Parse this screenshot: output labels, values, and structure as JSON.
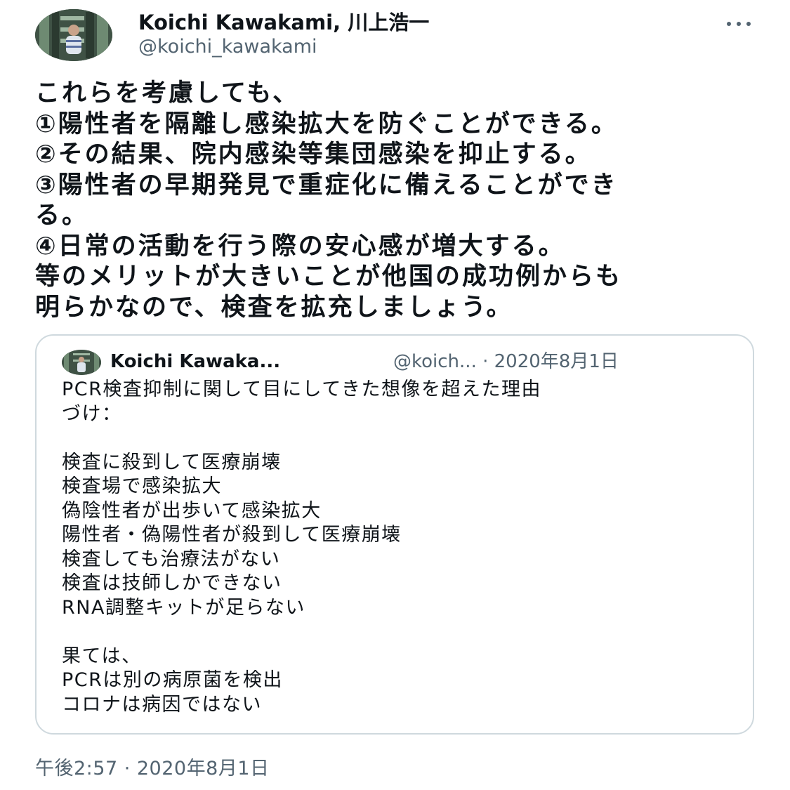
{
  "author": {
    "display_name": "Koichi Kawakami, 川上浩一",
    "handle": "@koichi_kawakami",
    "avatar_icon": "profile-photo"
  },
  "more_icon": "more-horizontal-icon",
  "tweet": {
    "lines": [
      "これらを考慮しても、",
      "①陽性者を隔離し感染拡大を防ぐことができる。",
      "②その結果、院内感染等集団感染を抑止する。",
      "③陽性者の早期発見で重症化に備えることができ",
      "る。",
      "④日常の活動を行う際の安心感が増大する。",
      "等のメリットが大きいことが他国の成功例からも",
      "明らかなので、検査を拡充しましょう。"
    ],
    "timestamp": "午後2:57 · 2020年8月1日"
  },
  "quoted_tweet": {
    "display_name": "Koichi Kawaka...",
    "handle_date": "@koich... · 2020年8月1日",
    "lines": [
      "PCR検査抑制に関して目にしてきた想像を超えた理由",
      "づけ：",
      "",
      "検査に殺到して医療崩壊",
      "検査場で感染拡大",
      "偽陰性者が出歩いて感染拡大",
      "陽性者・偽陽性者が殺到して医療崩壊",
      "検査しても治療法がない",
      "検査は技師しかできない",
      "RNA調整キットが足らない",
      "",
      "果ては、",
      "PCRは別の病原菌を検出",
      "コロナは病因ではない"
    ]
  },
  "colors": {
    "text": "#0f1419",
    "secondary_text": "#536471",
    "border": "#cfd9de",
    "background": "#ffffff"
  }
}
